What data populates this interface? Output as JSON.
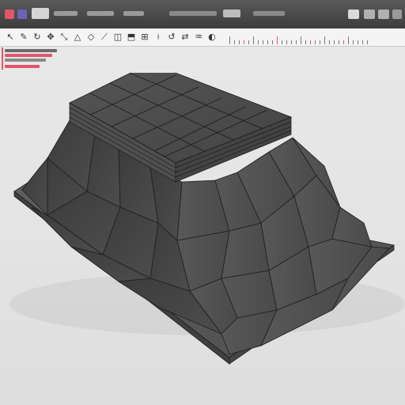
{
  "colors": {
    "titlebar": "#444444",
    "toolbar": "#f4f4f4",
    "viewport": "#e6e6e6",
    "mesh_top": "#4a4a4a",
    "mesh_side_light": "#5b5b5b",
    "mesh_side_dark": "#3a3a3a",
    "mesh_base": "#575757",
    "edge": "#1f1f1f",
    "accent_red": "#e0566a",
    "accent_purple": "#6a63b8",
    "accent_yellow": "#d9b93a"
  },
  "titlebar": {
    "icons": [
      "app-icon",
      "window-tab-icon",
      "minimize-icon",
      "maximize-icon",
      "close-icon"
    ]
  },
  "toolbar": {
    "tools": [
      {
        "icon": "selector-icon",
        "glyph": "↖"
      },
      {
        "icon": "pen-icon",
        "glyph": "✎"
      },
      {
        "icon": "rotate-icon",
        "glyph": "↻"
      },
      {
        "icon": "move-icon",
        "glyph": "✥"
      },
      {
        "icon": "scale-icon",
        "glyph": "⤡"
      },
      {
        "icon": "shape-icon",
        "glyph": "△"
      },
      {
        "icon": "vertex-icon",
        "glyph": "◇"
      },
      {
        "icon": "edge-icon",
        "glyph": "⟋"
      },
      {
        "icon": "face-icon",
        "glyph": "◫"
      },
      {
        "icon": "extrude-icon",
        "glyph": "⬒"
      },
      {
        "icon": "subdivide-icon",
        "glyph": "⊞"
      },
      {
        "icon": "knife-icon",
        "glyph": "⟊"
      },
      {
        "icon": "loop-icon",
        "glyph": "↺"
      },
      {
        "icon": "mirror-icon",
        "glyph": "⇄"
      },
      {
        "icon": "sculpt-icon",
        "glyph": "♒"
      },
      {
        "icon": "material-icon",
        "glyph": "◐"
      }
    ]
  },
  "viewport": {
    "model": "low-poly-mesa-mesh"
  }
}
